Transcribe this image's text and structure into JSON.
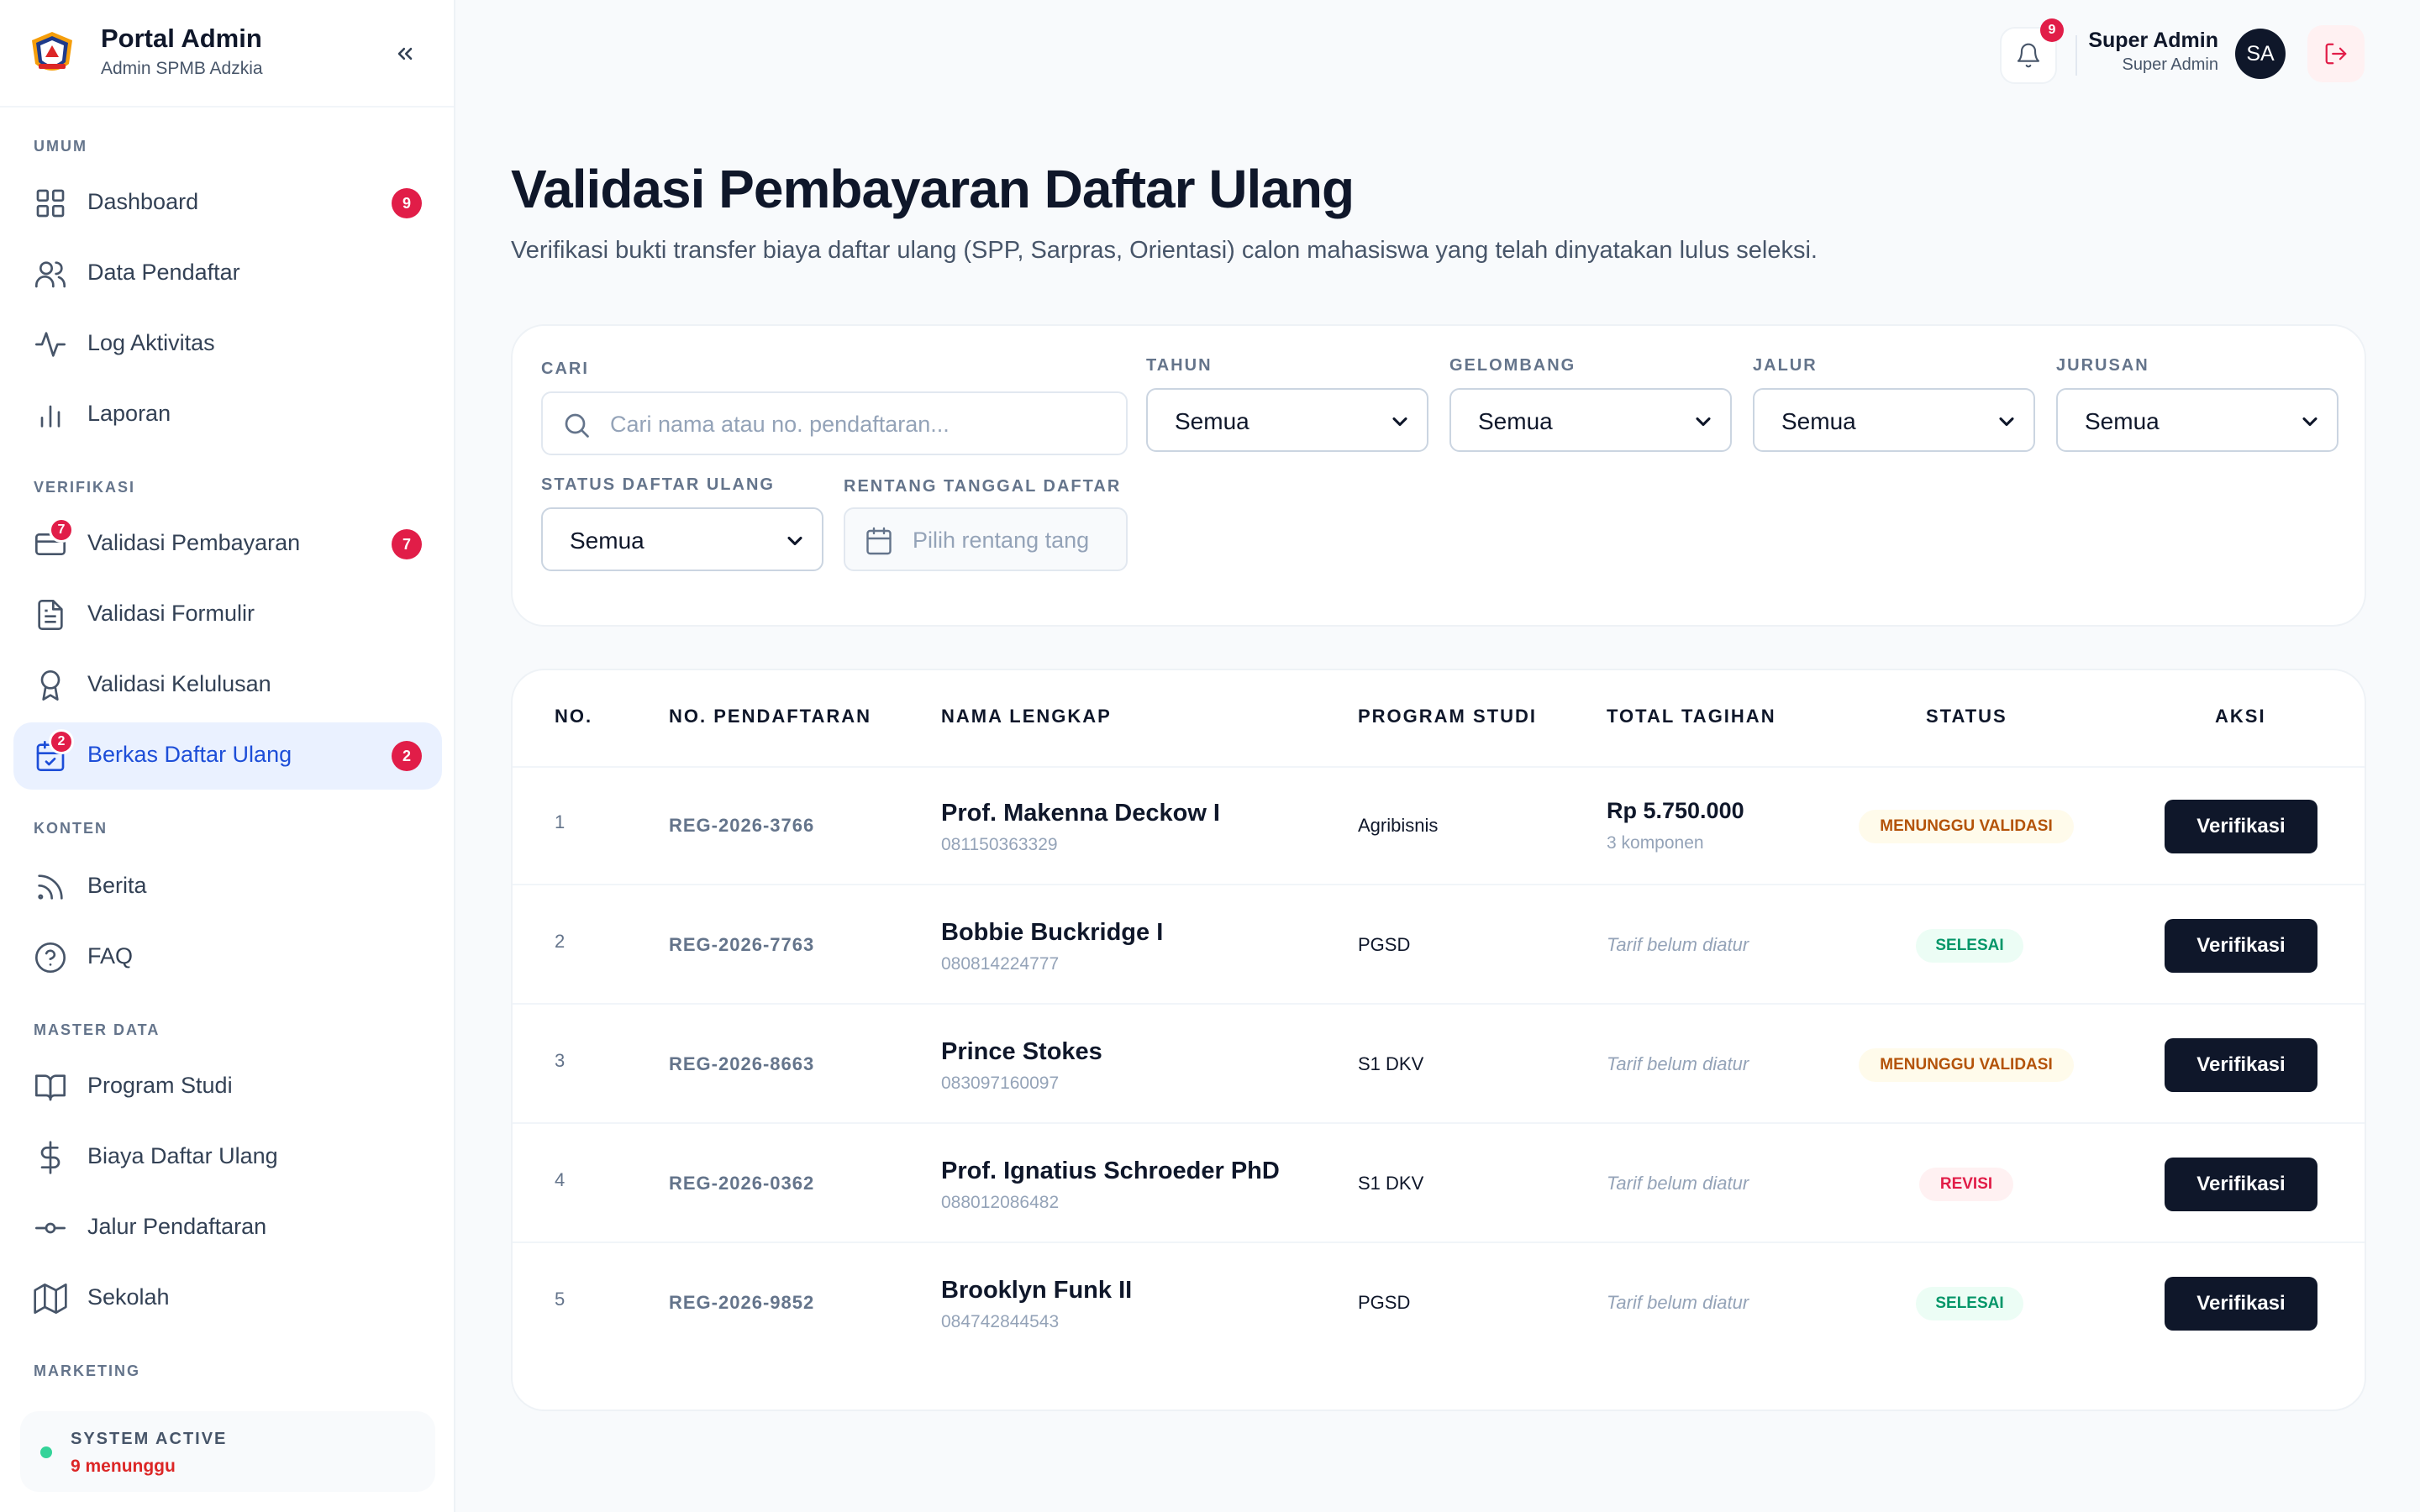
{
  "brand": {
    "title": "Portal Admin",
    "subtitle": "Admin SPMB Adzkia"
  },
  "sidebar": {
    "sections": [
      {
        "label": "UMUM"
      },
      {
        "label": "VERIFIKASI"
      },
      {
        "label": "KONTEN"
      },
      {
        "label": "MASTER DATA"
      },
      {
        "label": "MARKETING"
      }
    ],
    "items": [
      {
        "label": "Dashboard",
        "icon": "grid-icon",
        "count": "9"
      },
      {
        "label": "Data Pendaftar",
        "icon": "users-icon"
      },
      {
        "label": "Log Aktivitas",
        "icon": "activity-icon"
      },
      {
        "label": "Laporan",
        "icon": "bar-chart-icon"
      },
      {
        "label": "Validasi Pembayaran",
        "icon": "credit-card-icon",
        "count": "7",
        "dot": "7"
      },
      {
        "label": "Validasi Formulir",
        "icon": "file-text-icon"
      },
      {
        "label": "Validasi Kelulusan",
        "icon": "award-icon"
      },
      {
        "label": "Berkas Daftar Ulang",
        "icon": "calendar-check-icon",
        "count": "2",
        "dot": "2",
        "active": true
      },
      {
        "label": "Berita",
        "icon": "rss-icon"
      },
      {
        "label": "FAQ",
        "icon": "help-circle-icon"
      },
      {
        "label": "Program Studi",
        "icon": "book-open-icon"
      },
      {
        "label": "Biaya Daftar Ulang",
        "icon": "dollar-icon"
      },
      {
        "label": "Jalur Pendaftaran",
        "icon": "git-commit-icon"
      },
      {
        "label": "Sekolah",
        "icon": "map-icon"
      }
    ],
    "system": {
      "title": "SYSTEM ACTIVE",
      "subtitle": "9 menunggu"
    }
  },
  "header": {
    "notification_count": "9",
    "user_name": "Super Admin",
    "user_role": "Super Admin",
    "avatar_initials": "SA"
  },
  "page": {
    "title": "Validasi Pembayaran Daftar Ulang",
    "subtitle": "Verifikasi bukti transfer biaya daftar ulang (SPP, Sarpras, Orientasi) calon mahasiswa yang telah dinyatakan lulus seleksi."
  },
  "filters": {
    "search": {
      "label": "CARI",
      "placeholder": "Cari nama atau no. pendaftaran..."
    },
    "tahun": {
      "label": "TAHUN",
      "value": "Semua"
    },
    "gelombang": {
      "label": "GELOMBANG",
      "value": "Semua"
    },
    "jalur": {
      "label": "JALUR",
      "value": "Semua"
    },
    "jurusan": {
      "label": "JURUSAN",
      "value": "Semua"
    },
    "status": {
      "label": "STATUS DAFTAR ULANG",
      "value": "Semua"
    },
    "tanggal": {
      "label": "RENTANG TANGGAL DAFTAR",
      "placeholder": "Pilih rentang tang"
    }
  },
  "table": {
    "headers": [
      "NO.",
      "NO. PENDAFTARAN",
      "NAMA LENGKAP",
      "PROGRAM STUDI",
      "TOTAL TAGIHAN",
      "STATUS",
      "AKSI"
    ],
    "rows": [
      {
        "no": "1",
        "reg": "REG-2026-3766",
        "name": "Prof. Makenna Deckow I",
        "phone": "081150363329",
        "prodi": "Agribisnis",
        "amount": "Rp 5.750.000",
        "components": "3 komponen",
        "status": "MENUNGGU VALIDASI",
        "status_kind": "wait",
        "action": "Verifikasi"
      },
      {
        "no": "2",
        "reg": "REG-2026-7763",
        "name": "Bobbie Buckridge I",
        "phone": "080814224777",
        "prodi": "PGSD",
        "tarif": "Tarif belum diatur",
        "status": "SELESAI",
        "status_kind": "done",
        "action": "Verifikasi"
      },
      {
        "no": "3",
        "reg": "REG-2026-8663",
        "name": "Prince Stokes",
        "phone": "083097160097",
        "prodi": "S1 DKV",
        "tarif": "Tarif belum diatur",
        "status": "MENUNGGU VALIDASI",
        "status_kind": "wait",
        "action": "Verifikasi"
      },
      {
        "no": "4",
        "reg": "REG-2026-0362",
        "name": "Prof. Ignatius Schroeder PhD",
        "phone": "088012086482",
        "prodi": "S1 DKV",
        "tarif": "Tarif belum diatur",
        "status": "REVISI",
        "status_kind": "rev",
        "action": "Verifikasi"
      },
      {
        "no": "5",
        "reg": "REG-2026-9852",
        "name": "Brooklyn Funk II",
        "phone": "084742844543",
        "prodi": "PGSD",
        "tarif": "Tarif belum diatur",
        "status": "SELESAI",
        "status_kind": "done",
        "action": "Verifikasi"
      }
    ]
  },
  "colors": {
    "primary": "#0f172a",
    "accent": "#1d4ed8",
    "badge": "#e11d48",
    "wait": "#b45309",
    "done": "#059669",
    "revisi": "#e11d48"
  }
}
